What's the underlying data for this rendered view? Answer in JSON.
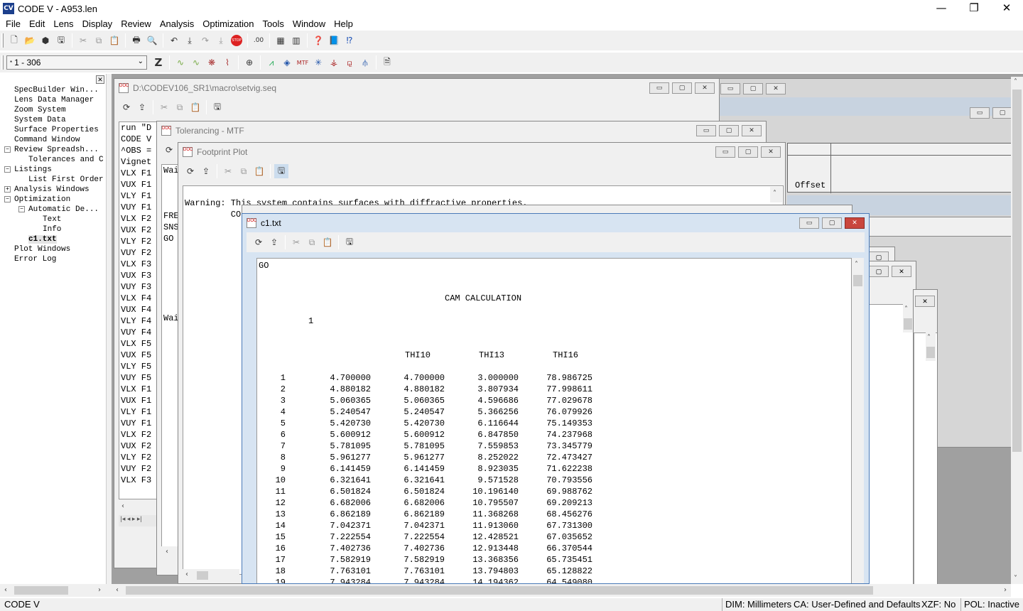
{
  "app": {
    "title": "CODE V - A953.len",
    "icon": "CV"
  },
  "menu": [
    "File",
    "Edit",
    "Lens",
    "Display",
    "Review",
    "Analysis",
    "Optimization",
    "Tools",
    "Window",
    "Help"
  ],
  "toolbar2": {
    "zoom_select": "1 - 306",
    "z_label": "Z"
  },
  "tree": {
    "items": [
      {
        "label": "SpecBuilder Win...",
        "indent": 0,
        "expander": ""
      },
      {
        "label": "Lens Data Manager",
        "indent": 0,
        "expander": ""
      },
      {
        "label": "Zoom System",
        "indent": 0,
        "expander": ""
      },
      {
        "label": "System Data",
        "indent": 0,
        "expander": ""
      },
      {
        "label": "Surface Properties",
        "indent": 0,
        "expander": ""
      },
      {
        "label": "Command Window",
        "indent": 0,
        "expander": ""
      },
      {
        "label": "Review Spreadsh...",
        "indent": 0,
        "expander": "−"
      },
      {
        "label": "Tolerances and C",
        "indent": 1,
        "expander": ""
      },
      {
        "label": "Listings",
        "indent": 0,
        "expander": "−"
      },
      {
        "label": "List First Order",
        "indent": 1,
        "expander": ""
      },
      {
        "label": "Analysis Windows",
        "indent": 0,
        "expander": "+"
      },
      {
        "label": "Optimization",
        "indent": 0,
        "expander": "−"
      },
      {
        "label": "Automatic De...",
        "indent": 1,
        "expander": "−"
      },
      {
        "label": "Text",
        "indent": 2,
        "expander": ""
      },
      {
        "label": "Info",
        "indent": 2,
        "expander": ""
      },
      {
        "label": "c1.txt",
        "indent": 1,
        "expander": "",
        "bold": true
      },
      {
        "label": "Plot Windows",
        "indent": 0,
        "expander": ""
      },
      {
        "label": "Error Log",
        "indent": 0,
        "expander": ""
      }
    ]
  },
  "windows": {
    "setvig": {
      "title": "D:\\CODEV106_SR1\\macro\\setvig.seq",
      "lines": [
        "run \"D",
        "CODE V",
        "^OBS =",
        "Vignet",
        "VLX F1",
        "VUX F1",
        "VLY F1",
        "VUY F1",
        "VLX F2",
        "VUX F2",
        "VLY F2",
        "VUY F2",
        "VLX F3",
        "VUX F3",
        "VUY F3",
        "VLX F4",
        "VUX F4",
        "VLY F4",
        "VUY F4",
        "VLX F5",
        "VUX F5",
        "VLY F5",
        "VUY F5",
        "VLX F1",
        "VUX F1",
        "VLY F1",
        "VUY F1",
        "VLX F2",
        "VUX F2",
        "VLY F2",
        "VUY F2",
        "VLX F3"
      ]
    },
    "tolerancing": {
      "title": "Tolerancing - MTF",
      "lines": [
        "Wai",
        "",
        "",
        "",
        "FRE",
        "SNS",
        "GO",
        "",
        "",
        "",
        "",
        "",
        "",
        "Wai"
      ]
    },
    "footprint": {
      "title": "Footprint Plot",
      "line1": "Warning: This system contains surfaces with diffractive properties.",
      "line2": "         CODE V analyses only consider energy contained in the designated"
    },
    "spreadsheet": {
      "column_header": "Offset"
    },
    "c1": {
      "title": "c1.txt",
      "go": "GO",
      "heading": "CAM CALCULATION",
      "zoom_index": "1",
      "columns": [
        "THI10",
        "THI13",
        "THI16"
      ],
      "rows": [
        [
          "1",
          "4.700000",
          "4.700000",
          "3.000000",
          "78.986725"
        ],
        [
          "2",
          "4.880182",
          "4.880182",
          "3.807934",
          "77.998611"
        ],
        [
          "3",
          "5.060365",
          "5.060365",
          "4.596686",
          "77.029678"
        ],
        [
          "4",
          "5.240547",
          "5.240547",
          "5.366256",
          "76.079926"
        ],
        [
          "5",
          "5.420730",
          "5.420730",
          "6.116644",
          "75.149353"
        ],
        [
          "6",
          "5.600912",
          "5.600912",
          "6.847850",
          "74.237968"
        ],
        [
          "7",
          "5.781095",
          "5.781095",
          "7.559853",
          "73.345779"
        ],
        [
          "8",
          "5.961277",
          "5.961277",
          "8.252022",
          "72.473427"
        ],
        [
          "9",
          "6.141459",
          "6.141459",
          "8.923035",
          "71.622238"
        ],
        [
          "10",
          "6.321641",
          "6.321641",
          "9.571528",
          "70.793556"
        ],
        [
          "11",
          "6.501824",
          "6.501824",
          "10.196140",
          "69.988762"
        ],
        [
          "12",
          "6.682006",
          "6.682006",
          "10.795507",
          "69.209213"
        ],
        [
          "13",
          "6.862189",
          "6.862189",
          "11.368268",
          "68.456276"
        ],
        [
          "14",
          "7.042371",
          "7.042371",
          "11.913060",
          "67.731300"
        ],
        [
          "15",
          "7.222554",
          "7.222554",
          "12.428521",
          "67.035652"
        ],
        [
          "16",
          "7.402736",
          "7.402736",
          "12.913448",
          "66.370544"
        ],
        [
          "17",
          "7.582919",
          "7.582919",
          "13.368356",
          "65.735451"
        ],
        [
          "18",
          "7.763101",
          "7.763101",
          "13.794803",
          "65.128822"
        ],
        [
          "19",
          "7.943284",
          "7.943284",
          "14.194362",
          "64.549080"
        ]
      ]
    }
  },
  "status": {
    "left": "CODE V",
    "dim": "DIM: Millimeters",
    "ca": "CA: User-Defined and Defaults",
    "xzf": "XZF: No",
    "pol": "POL: Inactive"
  }
}
